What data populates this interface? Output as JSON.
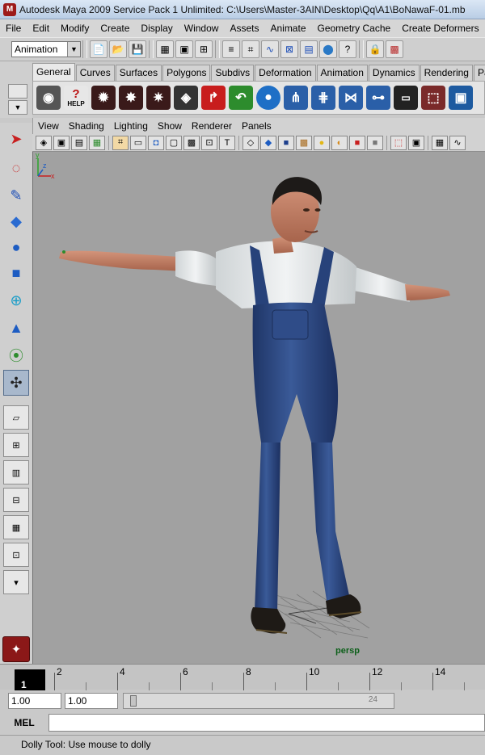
{
  "window": {
    "title": "Autodesk Maya 2009 Service Pack 1 Unlimited: C:\\Users\\Master-3AIN\\Desktop\\Qq\\A1\\BoNawaF-01.mb"
  },
  "menubar": {
    "items": [
      "File",
      "Edit",
      "Modify",
      "Create",
      "Display",
      "Window",
      "Assets",
      "Animate",
      "Geometry Cache",
      "Create Deformers"
    ]
  },
  "statusline": {
    "mode": "Animation"
  },
  "shelf": {
    "tabs": [
      "General",
      "Curves",
      "Surfaces",
      "Polygons",
      "Subdivs",
      "Deformation",
      "Animation",
      "Dynamics",
      "Rendering",
      "PaintEffects"
    ],
    "active_tab": "General",
    "help_label": "HELP"
  },
  "panel": {
    "menus": [
      "View",
      "Shading",
      "Lighting",
      "Show",
      "Renderer",
      "Panels"
    ],
    "camera": "persp",
    "axis_labels": {
      "x": "x",
      "y": "y",
      "z": "z"
    }
  },
  "timeline": {
    "current_frame": "1",
    "tick_labels": [
      "2",
      "4",
      "6",
      "8",
      "10",
      "12",
      "14"
    ]
  },
  "range": {
    "start": "1.00",
    "playback_start": "1.00",
    "end_hint": "24"
  },
  "commandline": {
    "label": "MEL",
    "value": ""
  },
  "helpline": {
    "text": "Dolly Tool: Use mouse to dolly"
  },
  "colors": {
    "viewport_bg": "#a1a1a1",
    "overalls": "#2d4a86",
    "shirt": "#e8ecee",
    "skin": "#c8866a",
    "maya_red": "#8b1818"
  }
}
